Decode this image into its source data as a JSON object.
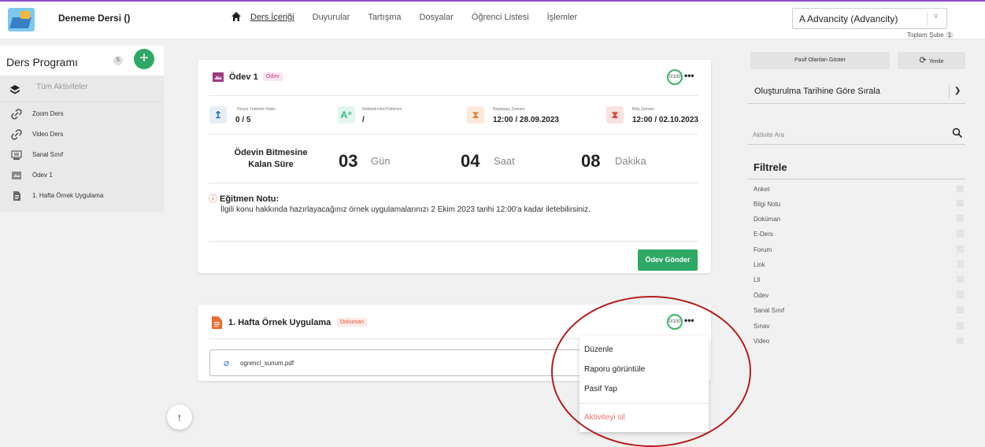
{
  "header": {
    "course_title": "Deneme Dersi ()",
    "nav": [
      "Ders İçeriği",
      "Duyurular",
      "Tartışma",
      "Dosyalar",
      "Öğrenci Listesi",
      "İşlemler"
    ],
    "branch_select": "A Advancity (Advancity)",
    "total_branch_label": "Toplam Şube",
    "total_branch_count": "1"
  },
  "sidebar": {
    "title": "Ders Programı",
    "count": "5",
    "all_label": "Tüm Aktiviteler",
    "items": [
      {
        "label": "Zoom Ders",
        "icon": "link-icon"
      },
      {
        "label": "Video Ders",
        "icon": "link-icon"
      },
      {
        "label": "Sanal Sınıf",
        "icon": "virtual-class-icon"
      },
      {
        "label": "Ödev 1",
        "icon": "assignment-icon"
      },
      {
        "label": "1. Hafta Örnek Uygulama",
        "icon": "document-icon"
      }
    ]
  },
  "card1": {
    "title": "Ödev 1",
    "tag": "Ödev",
    "score": "0/100",
    "stats": [
      {
        "label": "Dosya Yükleme Hakkı",
        "value": "0 / 5"
      },
      {
        "label": "Notlandırılan/Yüklenen",
        "value": "/"
      },
      {
        "label": "Başlangıç Zamanı:",
        "value": "12:00 / 28.09.2023"
      },
      {
        "label": "Bitiş Zamanı:",
        "value": "12:00 / 02.10.2023"
      }
    ],
    "remaining_label": "Ödevin Bitmesine Kalan Süre",
    "countdown": [
      {
        "num": "03",
        "unit": "Gün"
      },
      {
        "num": "04",
        "unit": "Saat"
      },
      {
        "num": "08",
        "unit": "Dakika"
      }
    ],
    "note_title": "Eğitmen Notu:",
    "note_text": "İlgili konu hakkında hazırlayacağınız örnek uygulamalarınızı 2 Ekim 2023 tarihi 12:00'a kadar iletebilirsiniz.",
    "submit_label": "Ödev Gönder"
  },
  "card2": {
    "title": "1. Hafta Örnek Uygulama",
    "tag": "Doküman",
    "score": "0/100",
    "file_name": "ogrenci_sunum.pdf"
  },
  "context_menu": {
    "items": [
      "Düzenle",
      "Raporu görüntüle",
      "Pasif Yap"
    ],
    "delete_label": "Aktiviteyi sil"
  },
  "right_panel": {
    "show_passive": "Pasif Olanları Göster",
    "refresh": "Yenile",
    "sort_select": "Oluşturulma Tarihine Göre Sırala",
    "search_placeholder": "Aktivite Ara",
    "filter_title": "Filtrele",
    "filters": [
      "Anket",
      "Bilgi Notu",
      "Doküman",
      "E-Ders",
      "Forum",
      "Link",
      "Lti",
      "Ödev",
      "Sanal Sınıf",
      "Sınav",
      "Video"
    ]
  },
  "colors": {
    "accent_green": "#2ea865",
    "top_border_purple": "#8a4fd0",
    "annotation_red": "#b51c1c"
  }
}
